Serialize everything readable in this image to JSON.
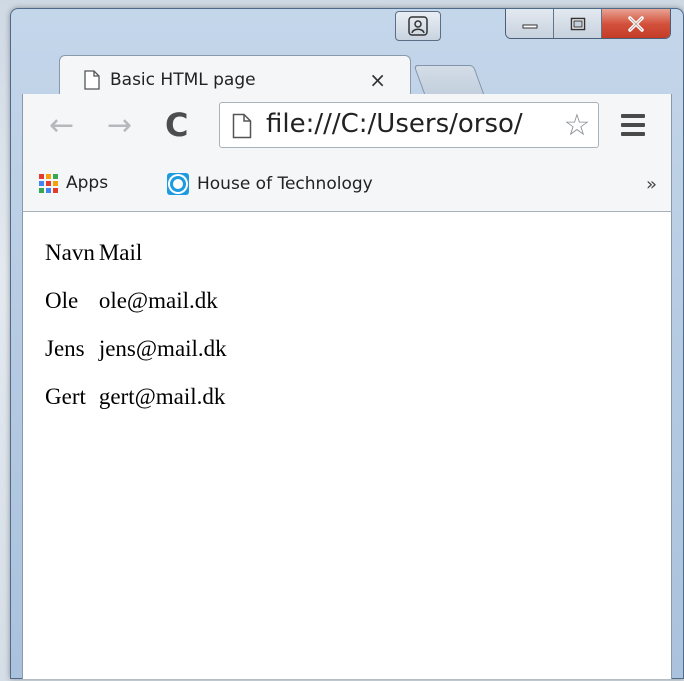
{
  "browser": {
    "tab": {
      "title": "Basic HTML page",
      "close_glyph": "×"
    },
    "toolbar": {
      "back_glyph": "←",
      "forward_glyph": "→",
      "reload_glyph": "C",
      "url": "file:///C:/Users/orso/",
      "star_glyph": "☆",
      "menu_icon": "hamburger-menu-icon"
    },
    "bookmarks": {
      "items": [
        {
          "label": "Apps",
          "icon": "apps-grid-icon"
        },
        {
          "label": "House of Technology",
          "icon": "house-of-technology-icon"
        }
      ],
      "more_glyph": "»"
    },
    "colors": {
      "window_frame": "#b3c9e1",
      "close_button": "#c23a26",
      "chrome_surface": "#f5f6f7",
      "page_background": "#ffffff"
    }
  },
  "page": {
    "table": {
      "headers": [
        "Navn",
        "Mail"
      ],
      "rows": [
        [
          "Ole",
          "ole@mail.dk"
        ],
        [
          "Jens",
          "jens@mail.dk"
        ],
        [
          "Gert",
          "gert@mail.dk"
        ]
      ]
    }
  }
}
